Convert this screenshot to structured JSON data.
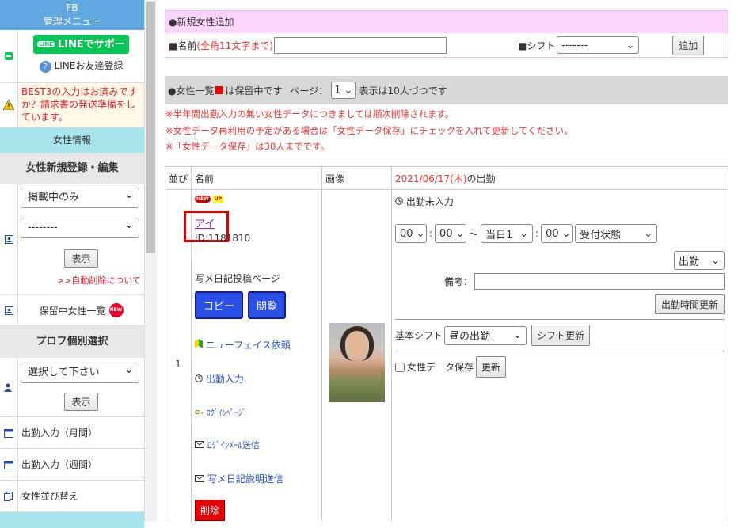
{
  "sidebar": {
    "head_line1": "FB",
    "head_line2": "管理メニュー",
    "line_button": "LINEでサポート",
    "line_badge": "LINE",
    "line_friend": "LINEお友達登録",
    "warning": "BEST3の入力はお済みですか？請求書の発送準備をしています。",
    "section_girl_info": "女性情報",
    "title_register": "女性新規登録・編集",
    "select_status": "掲載中のみ",
    "select_second": "--------",
    "show_button": "表示",
    "auto_delete_link": ">>自動削除について",
    "held_list": "保留中女性一覧",
    "new_badge": "NEW",
    "title_profile": "プロフ個別選択",
    "select_profile": "選択して下さい",
    "show_button2": "表示",
    "item_monthly": "出勤入力（月間）",
    "item_weekly": "出勤入力（週間）",
    "item_sort": "女性並び替え"
  },
  "new_girl": {
    "head": "●新規女性追加",
    "name_label": "■名前",
    "name_hint": "(全角11文字まで)",
    "name_value": "",
    "shift_label": "■シフト",
    "shift_value": "-------",
    "add_button": "追加"
  },
  "list_head": {
    "prefix": "●女性一覧",
    "held_note": "は保留中です",
    "page_label": "ページ：",
    "page_value": "1",
    "per_page": "表示は10人づつです"
  },
  "notes": [
    "※半年間出勤入力の無い女性データにつきましては順次削除されます。",
    "※女性データ再利用の予定がある場合は「女性データ保存」にチェックを入れて更新してください。",
    "※「女性データ保存」は30人までです。"
  ],
  "table": {
    "col_order": "並び",
    "col_name": "名前",
    "col_image": "画像",
    "col_date": "2021/06/17(木)",
    "col_date_suffix": "の出勤",
    "row": {
      "order": "1",
      "badge_new": "NEW",
      "badge_up": "UP",
      "name": "アイ",
      "id": "ID:1181810",
      "diary_page": "写メ日記投稿ページ",
      "copy_button": "コピー",
      "view_button": "閲覧",
      "newface_link": "ニューフェイス依頼",
      "attendance_link": "出勤入力",
      "login_page_link": "ﾛｸﾞｲﾝﾍﾟｰｼﾞ",
      "login_mail_link": "ﾛｸﾞｲﾝﾒｰﾙ送信",
      "diary_mail_link": "写メ日記説明送信",
      "delete_button": "削除",
      "attendance_status": "出勤未入力",
      "start_hour": "00",
      "start_min": "00",
      "tilde": "〜",
      "end_day": "当日1",
      "end_min": "00",
      "reception": "受付状態",
      "work_select": "出勤",
      "remarks_label": "備考：",
      "remarks_value": "",
      "update_time_button": "出勤時間更新",
      "base_shift_label": "基本シフト",
      "base_shift_value": "昼の出勤",
      "shift_update_button": "シフト更新",
      "save_label": "女性データ保存",
      "save_update_button": "更新"
    }
  },
  "colors": {
    "accent_blue": "#2b50e8",
    "red": "#e80000",
    "line_green": "#06c755",
    "pink_header": "#fbd5fb",
    "highlight_box": "#e00000"
  }
}
